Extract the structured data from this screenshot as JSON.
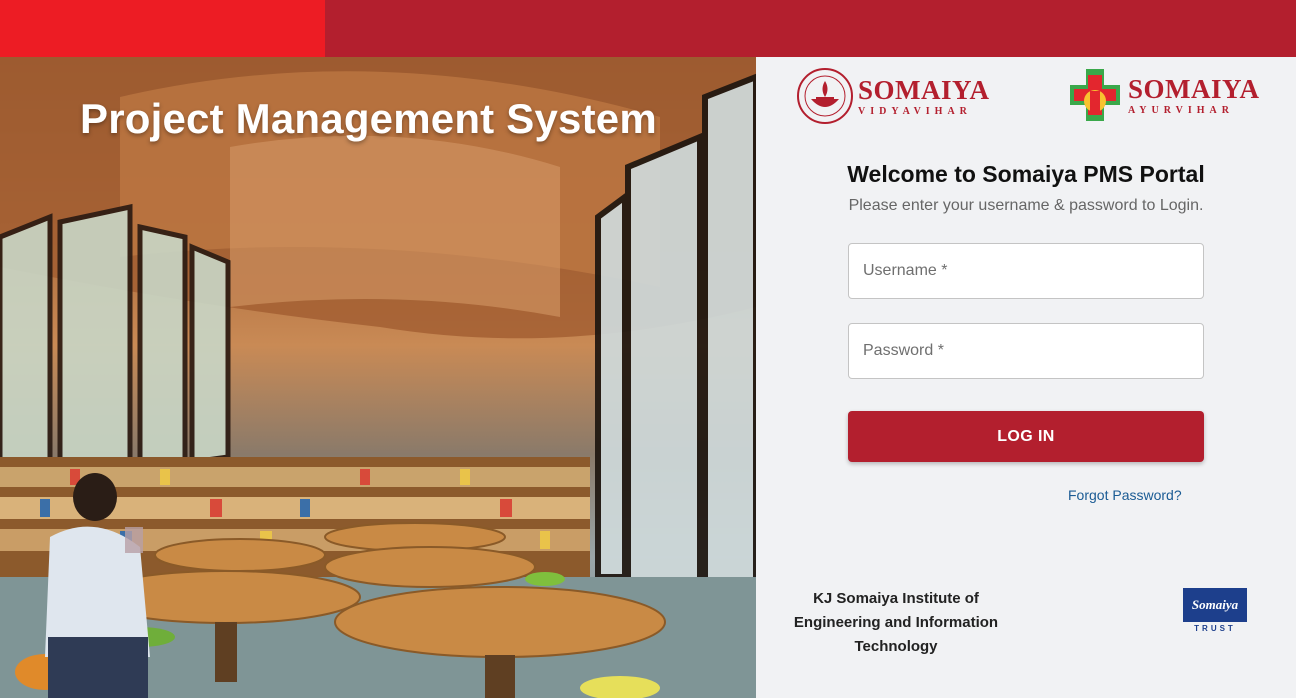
{
  "hero": {
    "title": "Project Management System"
  },
  "logos": {
    "vidyavihar": {
      "main": "SOMAIYA",
      "sub": "VIDYAVIHAR",
      "icon": "diya-lamp-icon"
    },
    "ayurvihar": {
      "main": "SOMAIYA",
      "sub": "AYURVIHAR",
      "icon": "medical-cross-icon"
    }
  },
  "login": {
    "welcome": "Welcome to Somaiya PMS Portal",
    "subtitle": "Please enter your username & password to Login.",
    "username_placeholder": "Username *",
    "password_placeholder": "Password *",
    "button_label": "LOG IN",
    "forgot_label": "Forgot Password?"
  },
  "footer": {
    "institute": "KJ Somaiya Institute of Engineering and Information Technology",
    "trust_top": "Somaiya",
    "trust_bottom": "TRUST"
  },
  "colors": {
    "brand_red": "#b31f2e",
    "accent_red": "#ed1c24",
    "link_blue": "#1a5b94",
    "trust_blue": "#1d3f8c"
  }
}
